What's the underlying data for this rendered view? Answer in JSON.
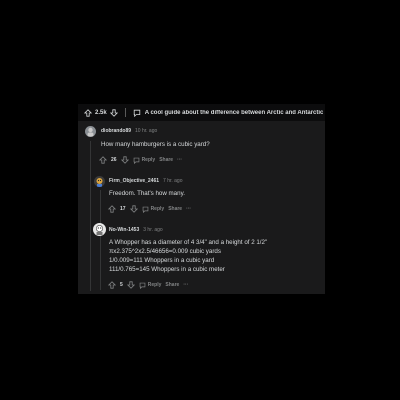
{
  "topbar": {
    "vote_count": "2.5k",
    "post_title": "A cool guide about the difference between Arctic and Antarctic"
  },
  "comments": [
    {
      "username": "diobrando89",
      "time": "10 hr. ago",
      "lines": [
        "How many hamburgers is a cubic yard?"
      ],
      "votes": "26",
      "reply_label": "Reply",
      "share_label": "Share",
      "more_label": "···"
    },
    {
      "username": "Firm_Objective_2461",
      "time": "7 hr. ago",
      "lines": [
        "Freedom. That's how many."
      ],
      "votes": "17",
      "reply_label": "Reply",
      "share_label": "Share",
      "more_label": "···"
    },
    {
      "username": "No-Win-1453",
      "time": "3 hr. ago",
      "lines": [
        "A Whopper has a diameter of 4 3/4\" and a height of 2 1/2\"",
        "πx2.375^2x2.5/46656=0.009 cubic yards",
        "1/0.009=111 Whoppers in a cubic yard",
        "111/0.765=145 Whoppers in a cubic meter"
      ],
      "votes": "5",
      "reply_label": "Reply",
      "share_label": "Share",
      "more_label": "···"
    }
  ],
  "colors": {
    "background": "#000000",
    "panel": "#1a1a1b",
    "text": "#d7dadc",
    "muted": "#818384"
  }
}
